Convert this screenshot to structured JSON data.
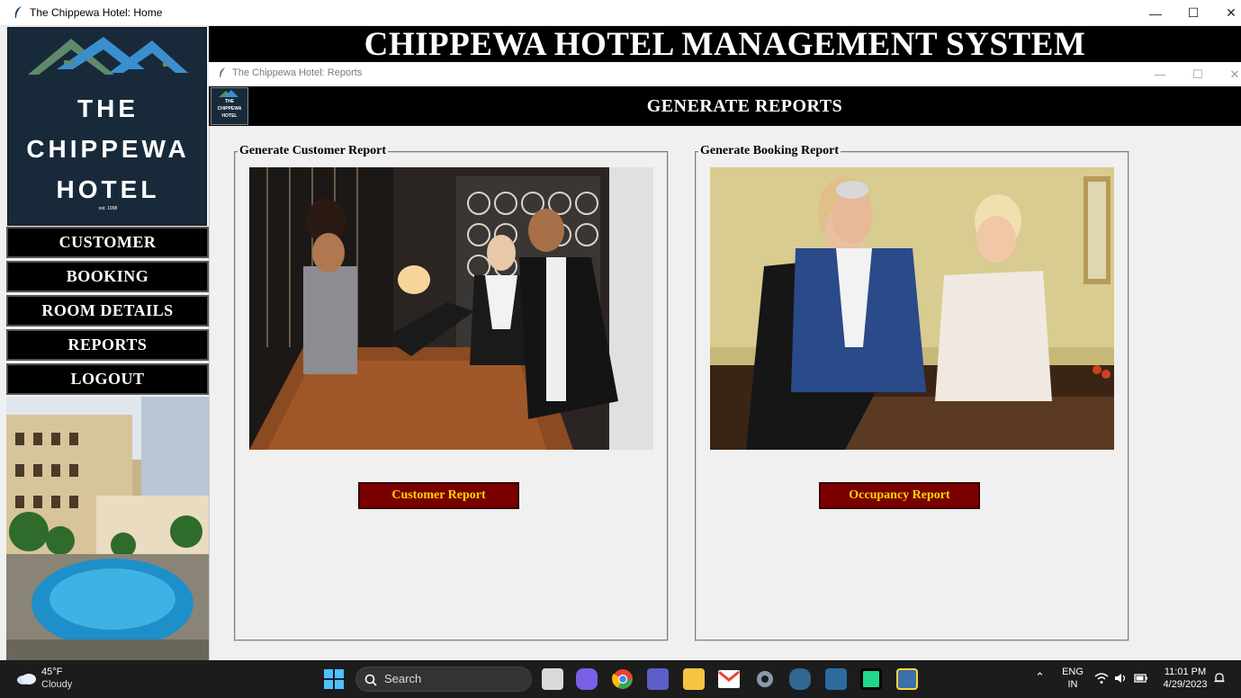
{
  "main_window": {
    "title": "The Chippewa Hotel: Home",
    "header": "CHIPPEWA HOTEL MANAGEMENT SYSTEM"
  },
  "logo": {
    "line1": "THE",
    "line2": "CHIPPEWA",
    "line3": "HOTEL",
    "est": "est. 1998"
  },
  "sidebar": {
    "items": [
      {
        "label": "CUSTOMER"
      },
      {
        "label": "BOOKING"
      },
      {
        "label": "ROOM DETAILS"
      },
      {
        "label": "REPORTS"
      },
      {
        "label": "LOGOUT"
      }
    ]
  },
  "reports_window": {
    "title": "The Chippewa Hotel: Reports",
    "header": "GENERATE REPORTS",
    "small_logo": {
      "line1": "THE",
      "line2": "CHIPPEWA",
      "line3": "HOTEL"
    },
    "groups": [
      {
        "label": "Generate Customer Report",
        "button": "Customer Report"
      },
      {
        "label": "Generate Booking Report",
        "button": "Occupancy Report"
      }
    ]
  },
  "taskbar": {
    "weather_temp": "45°F",
    "weather_cond": "Cloudy",
    "search_placeholder": "Search",
    "lang_line1": "ENG",
    "lang_line2": "IN",
    "time": "11:01 PM",
    "date": "4/29/2023"
  },
  "colors": {
    "header_bg": "#000000",
    "button_bg": "#7a0000",
    "button_text": "#ffd400",
    "logo_bg": "#182a3a"
  }
}
